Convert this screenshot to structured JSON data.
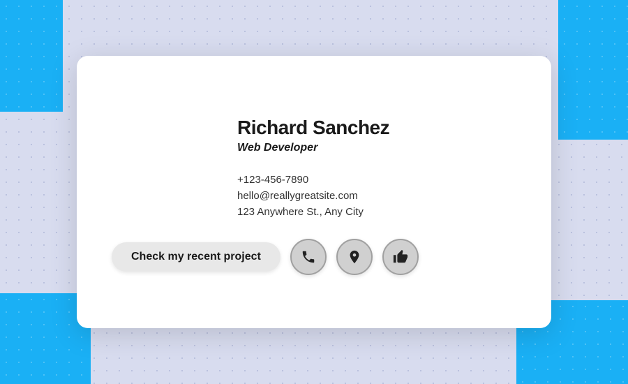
{
  "background": {
    "base_color": "#d8dcef",
    "dot_color": "#b0b8d8",
    "blue_color": "#1ab0f5"
  },
  "card": {
    "name": "Richard Sanchez",
    "title": "Web Developer",
    "phone": "+123-456-7890",
    "email": "hello@reallygreatsite.com",
    "address": "123 Anywhere St., Any City",
    "cta_button": "Check my recent project",
    "icons": [
      {
        "id": "phone",
        "label": "Phone",
        "symbol": "phone-icon"
      },
      {
        "id": "location",
        "label": "Location",
        "symbol": "location-icon"
      },
      {
        "id": "thumbsup",
        "label": "Like",
        "symbol": "thumbsup-icon"
      }
    ]
  }
}
